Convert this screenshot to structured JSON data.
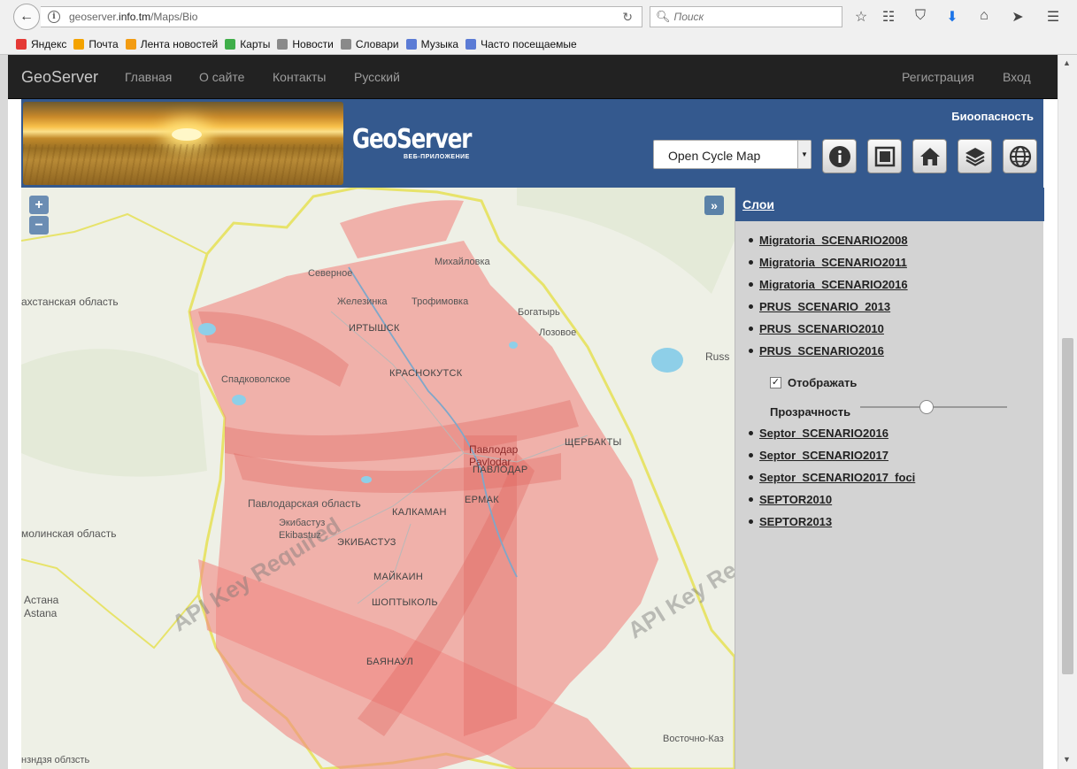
{
  "browser": {
    "url_prefix": "geoserver.",
    "url_host": "info.tm",
    "url_path": "/Maps/Bio",
    "search_placeholder": "Поиск",
    "bookmarks": [
      {
        "label": "Яндекс",
        "color": "#e53935"
      },
      {
        "label": "Почта",
        "color": "#f4a300"
      },
      {
        "label": "Лента новостей",
        "color": "#f39c12"
      },
      {
        "label": "Карты",
        "color": "#3fae49"
      },
      {
        "label": "Новости",
        "color": "#8a8a8a"
      },
      {
        "label": "Словари",
        "color": "#8a8a8a"
      },
      {
        "label": "Музыка",
        "color": "#5b7bd5"
      },
      {
        "label": "Часто посещаемые",
        "color": "#5b7bd5"
      }
    ]
  },
  "navbar": {
    "brand": "GeoServer",
    "links": [
      "Главная",
      "О сайте",
      "Контакты",
      "Русский"
    ],
    "register": "Регистрация",
    "login": "Вход"
  },
  "header": {
    "logo": "GeoServer",
    "logo_sub": "ВЕБ-ПРИЛОЖЕНИЕ",
    "title": "Биоопасность",
    "map_select": "Open Cycle Map",
    "tools": [
      "info-icon",
      "fullscreen-icon",
      "home-icon",
      "layers-icon",
      "globe-icon"
    ]
  },
  "map": {
    "zoom_in": "+",
    "zoom_out": "−",
    "expand": "»",
    "watermark": "API Key Required",
    "places": [
      {
        "name": "Михайловка"
      },
      {
        "name": "Северное"
      },
      {
        "name": "Железинка"
      },
      {
        "name": "Трофимовка"
      },
      {
        "name": "ИРТЫШСК"
      },
      {
        "name": "Богатырь"
      },
      {
        "name": "Лозовое"
      },
      {
        "name": "ахстанская область"
      },
      {
        "name": "Russ"
      },
      {
        "name": "Спадковолское"
      },
      {
        "name": "КРАСНОКУТСК"
      },
      {
        "name": "Павлодар"
      },
      {
        "name": "Pavlodar"
      },
      {
        "name": "ПАВЛОДАР"
      },
      {
        "name": "ЩЕРБАКТЫ"
      },
      {
        "name": "Павлодарская область"
      },
      {
        "name": "ЕРМАК"
      },
      {
        "name": "КАЛКАМАН"
      },
      {
        "name": "Экибастуз"
      },
      {
        "name": "Ekibastuz"
      },
      {
        "name": "ЭКИБАСТУЗ"
      },
      {
        "name": "молинская область"
      },
      {
        "name": "МАЙКАИН"
      },
      {
        "name": "ШОПТЫКОЛЬ"
      },
      {
        "name": "Астана"
      },
      {
        "name": "Astana"
      },
      {
        "name": "БАЯНАУЛ"
      },
      {
        "name": "Восточно-Каз"
      },
      {
        "name": "нзндзя облзсть"
      }
    ]
  },
  "panel": {
    "title": "Слои",
    "layers_top": [
      "Migratoria_SCENARIO2008",
      "Migratoria_SCENARIO2011",
      "Migratoria_SCENARIO2016",
      "PRUS_SCENARIO_2013",
      "PRUS_SCENARIO2010",
      "PRUS_SCENARIO2016"
    ],
    "display_label": "Отображать",
    "display_checked": true,
    "opacity_label": "Прозрачность",
    "opacity_value": 0.45,
    "layers_bottom": [
      "Septor_SCENARIO2016",
      "Septor_SCENARIO2017",
      "Septor_SCENARIO2017_foci",
      "SEPTOR2010",
      "SEPTOR2013"
    ]
  },
  "colors": {
    "navbar": "#222222",
    "header_band": "#34598e",
    "overlay": "#f08a84",
    "border": "#e7e36a",
    "panel": "#d3d3d3"
  }
}
